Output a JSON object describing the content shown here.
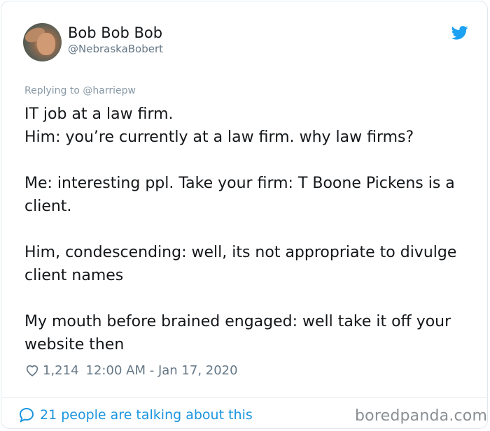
{
  "tweet": {
    "author_name": "Bob Bob Bob",
    "author_handle": "@NebraskaBobert",
    "replying_label": "Replying to",
    "replying_handle": "@harriepw",
    "paragraphs": [
      [
        "IT job at a law firm.",
        "Him: you’re currently at a law firm. why law firms?"
      ],
      [
        "Me: interesting ppl. Take your firm: T Boone Pickens is a client."
      ],
      [
        "Him, condescending: well, its not appropriate to divulge client names"
      ],
      [
        "My mouth before brained engaged: well take it off your website then"
      ]
    ],
    "likes": "1,214",
    "time": "12:00 AM",
    "date_separator": "-",
    "date": "Jan 17, 2020",
    "talking": "21 people are talking about this"
  },
  "watermark": "boredpanda.com",
  "colors": {
    "twitter_blue": "#1da1f2",
    "link_blue": "#1b95e0",
    "text": "#14171a",
    "muted": "#657786"
  },
  "icons": {
    "brand": "twitter-bird-icon",
    "like": "heart-icon",
    "conversation": "speech-bubble-icon"
  }
}
